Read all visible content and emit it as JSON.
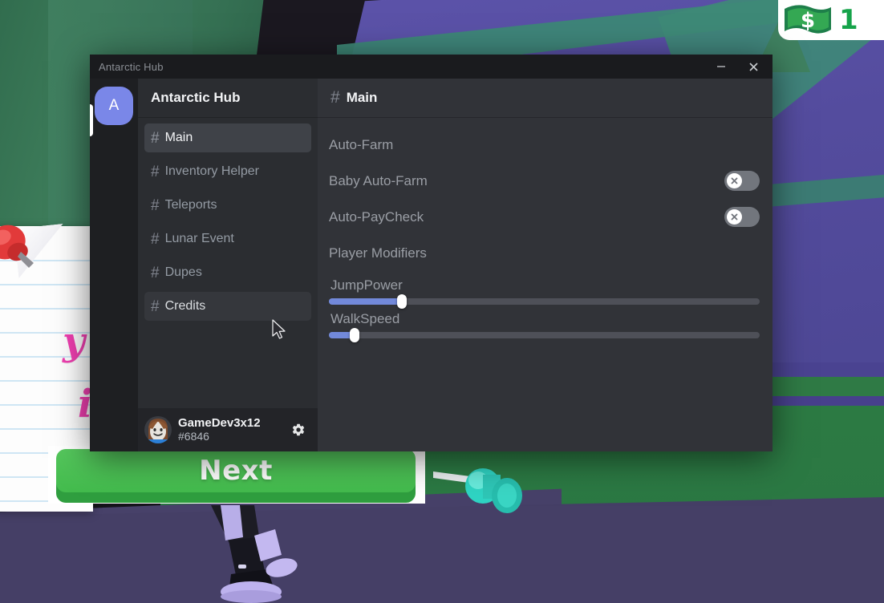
{
  "window": {
    "titlebar_title": "Antarctic Hub",
    "minimize_label": "–",
    "close_label": "✕"
  },
  "rail": {
    "guild_initial": "A"
  },
  "sidebar": {
    "header_title": "Antarctic Hub",
    "channels": [
      {
        "hash": "#",
        "label": "Main",
        "state": "active"
      },
      {
        "hash": "#",
        "label": "Inventory Helper",
        "state": "normal"
      },
      {
        "hash": "#",
        "label": "Teleports",
        "state": "normal"
      },
      {
        "hash": "#",
        "label": "Lunar Event",
        "state": "normal"
      },
      {
        "hash": "#",
        "label": "Dupes",
        "state": "normal"
      },
      {
        "hash": "#",
        "label": "Credits",
        "state": "hover"
      }
    ],
    "user": {
      "name": "GameDev3x12",
      "tag": "#6846",
      "settings_icon": "gear-icon"
    }
  },
  "main": {
    "hash": "#",
    "channel_title": "Main",
    "items": [
      {
        "type": "section",
        "label": "Auto-Farm"
      },
      {
        "type": "toggle",
        "label": "Baby Auto-Farm",
        "value": "off",
        "knob_glyph": "✕"
      },
      {
        "type": "toggle",
        "label": "Auto-PayCheck",
        "value": "off",
        "knob_glyph": "✕"
      },
      {
        "type": "section",
        "label": "Player Modifiers"
      },
      {
        "type": "slider",
        "label": "JumpPower",
        "percent": 17
      },
      {
        "type": "slider",
        "label": "WalkSpeed",
        "percent": 6
      }
    ]
  },
  "game": {
    "next_button_label": "Next",
    "money_value": "1",
    "money_icon": "cash-icon",
    "note_text_line1": "y",
    "note_text_line2": "i"
  },
  "colors": {
    "accent_blurple": "#7289da",
    "guild_icon": "#7a87e8",
    "window_chrome": "#1a1b1e",
    "sidebar_bg": "#2b2d31",
    "main_bg": "#313338",
    "toggle_off": "#72767d",
    "next_green": "#43bb4d",
    "money_green": "#16a34a"
  }
}
